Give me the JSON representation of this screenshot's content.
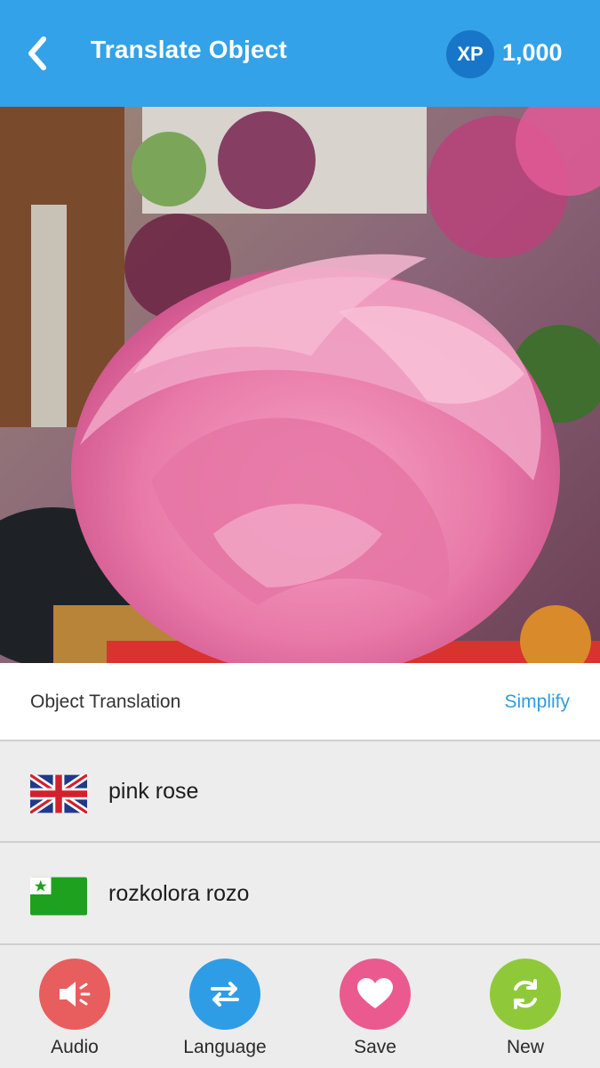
{
  "header": {
    "title": "Translate Object",
    "xp_badge": "XP",
    "xp_value": "1,000",
    "color": "#33a2e8"
  },
  "photo": {
    "subject": "pink rose"
  },
  "section": {
    "title": "Object Translation",
    "action": "Simplify"
  },
  "translations": [
    {
      "flag": "uk-flag-icon",
      "text": "pink rose"
    },
    {
      "flag": "esperanto-flag-icon",
      "text": "rozkolora rozo"
    }
  ],
  "actions": [
    {
      "label": "Audio",
      "icon": "speaker-icon",
      "color": "#e85d5d"
    },
    {
      "label": "Language",
      "icon": "swap-arrows-icon",
      "color": "#2f9de6"
    },
    {
      "label": "Save",
      "icon": "heart-icon",
      "color": "#ea5a8f"
    },
    {
      "label": "New",
      "icon": "refresh-icon",
      "color": "#8fc93a"
    }
  ]
}
